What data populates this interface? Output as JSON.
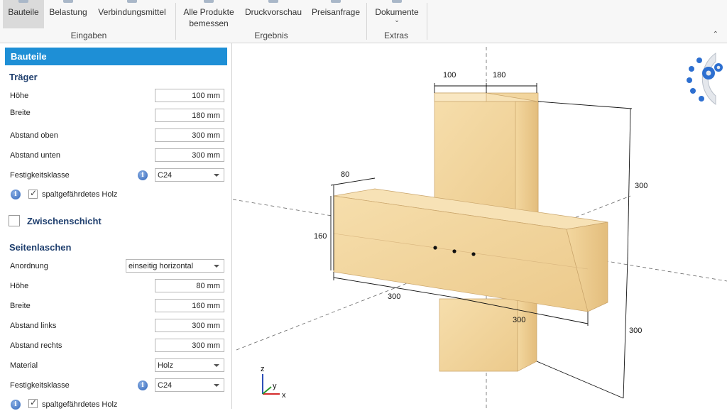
{
  "ribbon": {
    "buttons": {
      "bauteile": "Bauteile",
      "belastung": "Belastung",
      "verbindungsmittel": "Verbindungsmittel",
      "alle_produkte_l1": "Alle Produkte",
      "alle_produkte_l2": "bemessen",
      "druckvorschau": "Druckvorschau",
      "preisanfrage": "Preisanfrage",
      "dokumente": "Dokumente"
    },
    "groups": {
      "eingaben": "Eingaben",
      "ergebnis": "Ergebnis",
      "extras": "Extras"
    }
  },
  "panel": {
    "header": "Bauteile",
    "traeger": {
      "title": "Träger",
      "hoehe_label": "Höhe",
      "hoehe_value": "100 mm",
      "breite_label": "Breite",
      "breite_value": "180 mm",
      "abstand_oben_label": "Abstand oben",
      "abstand_oben_value": "300 mm",
      "abstand_unten_label": "Abstand unten",
      "abstand_unten_value": "300 mm",
      "festigkeit_label": "Festigkeitsklasse",
      "festigkeit_value": "C24",
      "spalt_label": "spaltgefährdetes Holz"
    },
    "zwischenschicht": {
      "title": "Zwischenschicht"
    },
    "seitenlaschen": {
      "title": "Seitenlaschen",
      "anordnung_label": "Anordnung",
      "anordnung_value": "einseitig horizontal",
      "hoehe_label": "Höhe",
      "hoehe_value": "80 mm",
      "breite_label": "Breite",
      "breite_value": "160 mm",
      "abstand_links_label": "Abstand links",
      "abstand_links_value": "300 mm",
      "abstand_rechts_label": "Abstand rechts",
      "abstand_rechts_value": "300 mm",
      "material_label": "Material",
      "material_value": "Holz",
      "festigkeit_label": "Festigkeitsklasse",
      "festigkeit_value": "C24",
      "spalt_label": "spaltgefährdetes Holz"
    }
  },
  "viewport": {
    "dims": {
      "top_left": "100",
      "top_right": "180",
      "lasche_top": "80",
      "lasche_left": "160",
      "right_upper": "300",
      "right_lower": "300",
      "bottom_left": "300",
      "bottom_right": "300"
    },
    "axes": {
      "z": "z",
      "y": "y",
      "x": "x"
    }
  },
  "colors": {
    "accent": "#1e8fd6",
    "section": "#1f3f6e",
    "wood": "#f2d7a2"
  }
}
